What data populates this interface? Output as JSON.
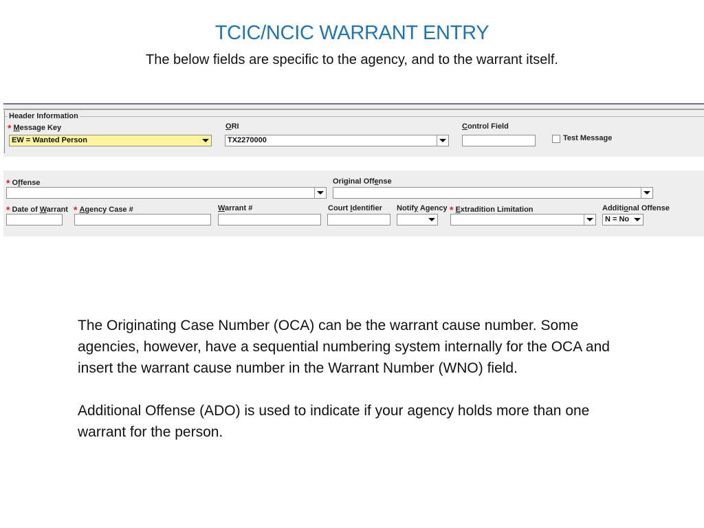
{
  "slide": {
    "title": "TCIC/NCIC WARRANT ENTRY",
    "subtitle": "The below fields are specific to the agency, and to the warrant itself.",
    "paragraphs": [
      "The Originating Case Number (OCA) can be the warrant cause number. Some agencies, however, have a sequential numbering system internally for the OCA and insert the warrant cause number in the Warrant Number (WNO) field.",
      "Additional Offense (ADO) is used to indicate if your agency holds more than one warrant for the person."
    ]
  },
  "header_panel": {
    "legend": "Header Information",
    "message_key": {
      "label_first": "M",
      "label_rest": "essage Key",
      "value": "EW = Wanted Person",
      "required": true
    },
    "ori": {
      "label_first": "O",
      "label_rest": "RI",
      "value": "TX2270000"
    },
    "control_field": {
      "label_first": "C",
      "label_rest": "ontrol Field",
      "value": ""
    },
    "test_message": {
      "label": "Test Message",
      "checked": false
    }
  },
  "warrant_panel": {
    "offense": {
      "label_a": "O",
      "label_u": "f",
      "label_b": "fense",
      "value": "",
      "required": true
    },
    "original_offense": {
      "label_a": "Original Off",
      "label_u": "e",
      "label_b": "nse",
      "value": ""
    },
    "date_of_warrant": {
      "label_a": "Date of ",
      "label_u": "W",
      "label_b": "arrant",
      "value": "",
      "required": true
    },
    "agency_case": {
      "label_a": "",
      "label_u": "A",
      "label_b": "gency Case #",
      "value": "",
      "required": true
    },
    "warrant_num": {
      "label_a": "",
      "label_u": "W",
      "label_b": "arrant #",
      "value": ""
    },
    "court_identifier": {
      "label_a": "Court ",
      "label_u": "I",
      "label_b": "dentifier",
      "value": ""
    },
    "notify_agency": {
      "label_a": "Notif",
      "label_u": "y",
      "label_b": " Agency",
      "value": ""
    },
    "extradition_limitation": {
      "label_a": "",
      "label_u": "E",
      "label_b": "xtradition Limitation",
      "value": "",
      "required": true
    },
    "additional_offense": {
      "label_a": "Additi",
      "label_u": "o",
      "label_b": "nal Offense",
      "value": "N = No"
    },
    "req_mark": "*"
  }
}
